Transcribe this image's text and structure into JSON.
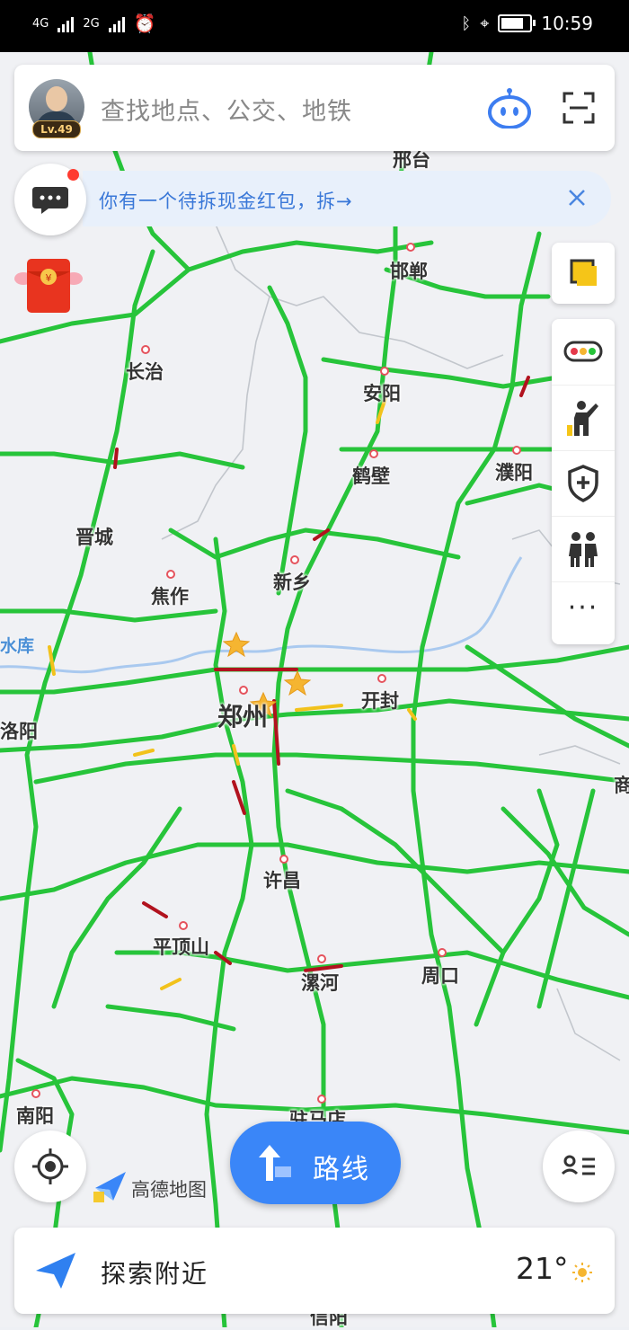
{
  "status_bar": {
    "network1": "4G",
    "network2": "2G",
    "time": "10:59"
  },
  "search": {
    "level": "Lv.49",
    "placeholder": "查找地点、公交、地铁"
  },
  "banner": {
    "message": "你有一个待拆现金红包，拆→"
  },
  "map": {
    "cities": [
      {
        "name": "邢台"
      },
      {
        "name": "邯郸"
      },
      {
        "name": "长治"
      },
      {
        "name": "安阳"
      },
      {
        "name": "鹤壁"
      },
      {
        "name": "濮阳"
      },
      {
        "name": "晋城"
      },
      {
        "name": "新乡"
      },
      {
        "name": "焦作"
      },
      {
        "name": "开封"
      },
      {
        "name": "郑州"
      },
      {
        "name": "洛阳"
      },
      {
        "name": "许昌"
      },
      {
        "name": "平顶山"
      },
      {
        "name": "漯河"
      },
      {
        "name": "周口"
      },
      {
        "name": "南阳"
      },
      {
        "name": "驻马店"
      },
      {
        "name": "商"
      },
      {
        "name": "信阳"
      }
    ],
    "water_label": "水库",
    "colors": {
      "road_clear": "#27c43a",
      "road_slow": "#f2c21b",
      "road_jam": "#b1121e",
      "river": "#a9c9ef"
    }
  },
  "tools": [
    "layers-icon",
    "traffic-icon",
    "report-icon",
    "safety-icon",
    "people-icon",
    "more-icon"
  ],
  "bottom": {
    "route_label": "路线",
    "brand": "高德地图",
    "explore_label": "探索附近",
    "temperature": "21°"
  }
}
